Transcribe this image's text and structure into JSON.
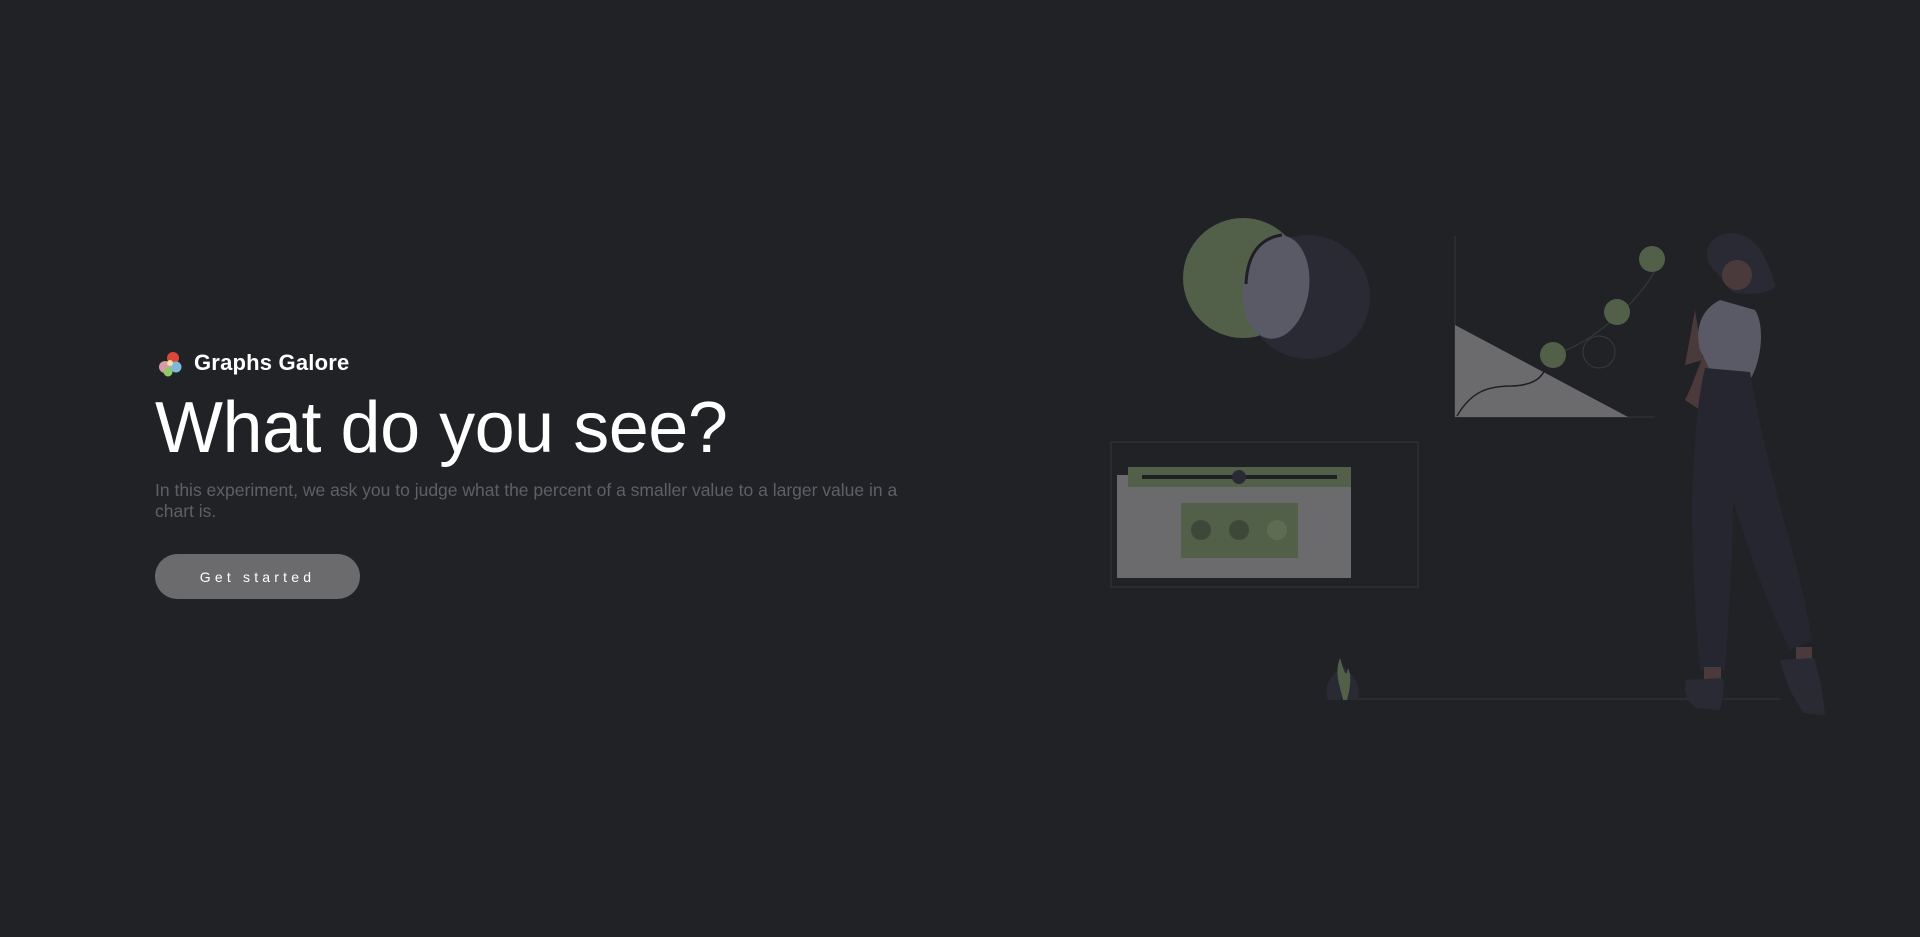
{
  "brand": {
    "name": "Graphs Galore",
    "logo_icon": "color-balls-icon"
  },
  "hero": {
    "headline": "What do you see?",
    "description": "In this experiment, we ask you to judge what the percent of a smaller value to a larger value in a chart is.",
    "cta_label": "Get started"
  },
  "illustration": {
    "icon": "data-analysis-person-illustration"
  },
  "colors": {
    "background": "#212226",
    "accent_green": "#52604a",
    "muted_gray": "#6b6b6d",
    "text_muted": "#5e6066"
  }
}
